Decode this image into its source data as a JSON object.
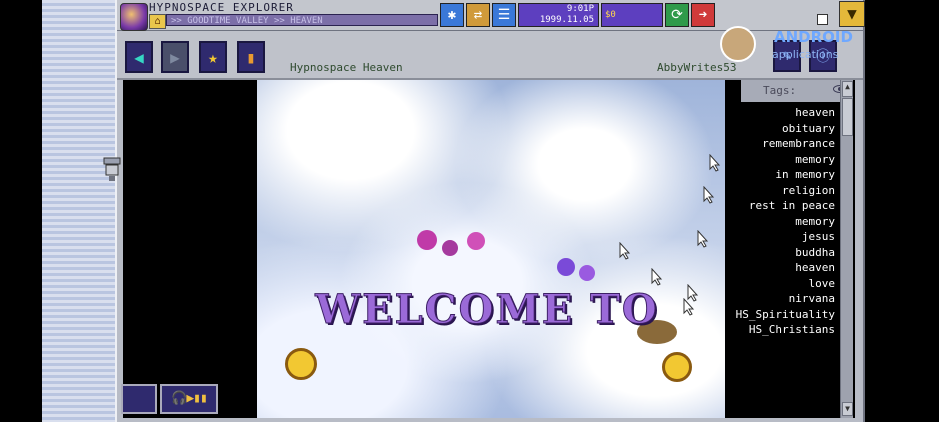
{
  "app": {
    "title": "HYPNOSPACE EXPLORER",
    "address": ">> GOODTIME VALLEY >> HEAVEN",
    "clock_time": "9:01P",
    "clock_date": "1999.11.05",
    "coins": "$0"
  },
  "page": {
    "site_title": "Hypnospace Heaven",
    "site_owner": "AbbyWrites53",
    "welcome_text": "WELCOME TO"
  },
  "tags": {
    "header": "Tags:",
    "items": [
      "heaven",
      "obituary",
      "remembrance",
      "memory",
      "in memory",
      "religion",
      "rest in peace",
      "memory",
      "jesus",
      "buddha",
      "heaven",
      "love",
      "nirvana",
      "HS_Spirituality",
      "HS_Christians"
    ]
  },
  "watermark": {
    "brand": "ANDROID",
    "sub": "applications"
  },
  "colors": {
    "accent": "#5d3fbf",
    "nav_button": "#2f2a6e",
    "home": "#e9c64c"
  }
}
